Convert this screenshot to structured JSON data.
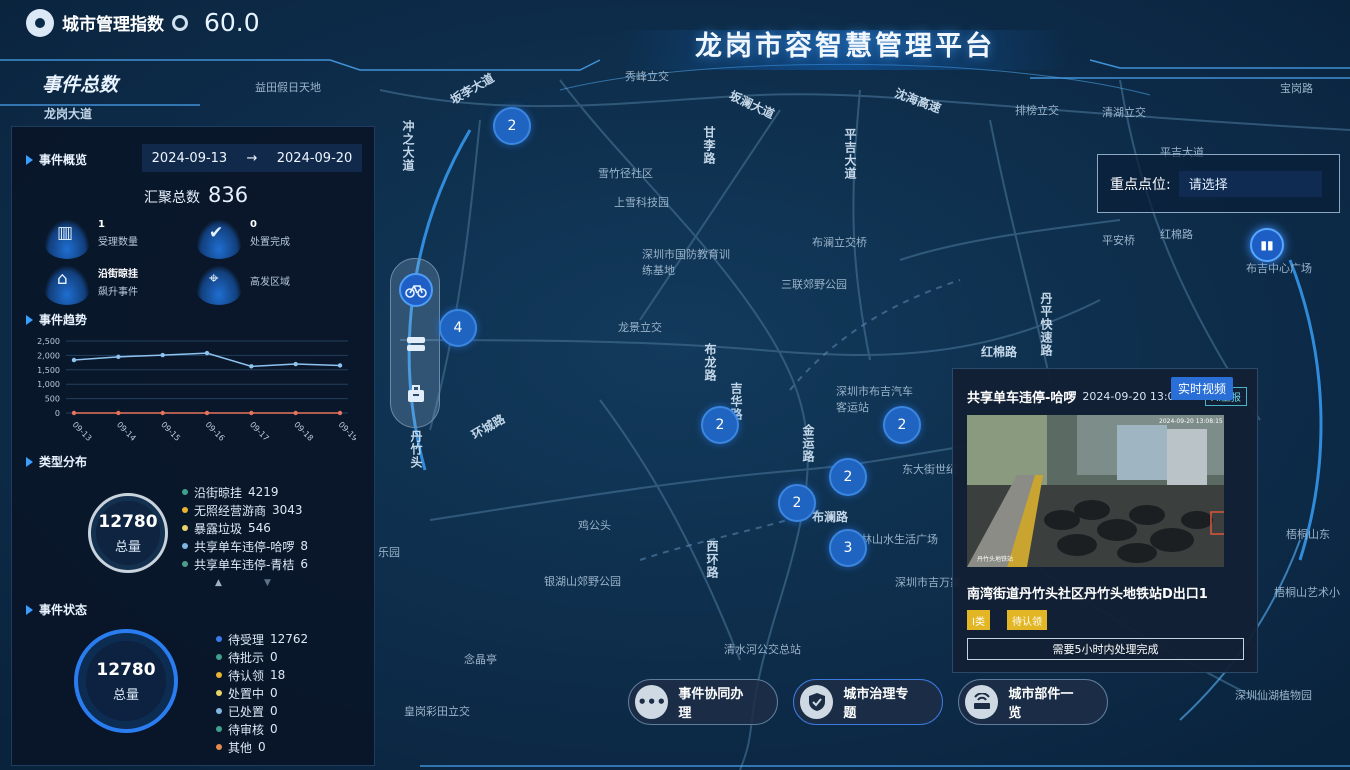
{
  "header": {
    "city_index_label": "城市管理指数",
    "city_index_value": "60.0",
    "platform_title": "龙岗市容智慧管理平台",
    "section_title": "事件总数"
  },
  "overview": {
    "title": "事件概览",
    "date_start": "2024-09-13",
    "date_arrow": "→",
    "date_end": "2024-09-20",
    "total_label": "汇聚总数",
    "total_value": "836",
    "kpis": [
      {
        "value": "1",
        "label": "受理数量",
        "icon": "books-icon"
      },
      {
        "value": "0",
        "label": "处置完成",
        "icon": "check-icon"
      },
      {
        "value": "沿街晾挂",
        "label": "飙升事件",
        "icon": "shop-icon"
      },
      {
        "value": "",
        "label": "高发区域",
        "icon": "location-pin-icon"
      }
    ]
  },
  "trend": {
    "title": "事件趋势"
  },
  "chart_data": {
    "type": "line",
    "categories": [
      "09-13",
      "09-14",
      "09-15",
      "09-16",
      "09-17",
      "09-18",
      "09-19"
    ],
    "y_ticks": [
      "2,500",
      "2,000",
      "1,500",
      "1,000",
      "500",
      "0"
    ],
    "ylim": [
      0,
      2500
    ],
    "series": [
      {
        "values": [
          1840,
          1950,
          2010,
          2080,
          1620,
          1700,
          1650
        ],
        "color": "#8ec3ef"
      },
      {
        "values": [
          0,
          0,
          0,
          0,
          0,
          0,
          0
        ],
        "color": "#e8735c"
      }
    ],
    "grid": true
  },
  "type_dist": {
    "title": "类型分布",
    "total": "12780",
    "total_label": "总量",
    "items": [
      {
        "name": "沿街晾挂",
        "value": "4219",
        "color": "#3fa28a"
      },
      {
        "name": "无照经营游商",
        "value": "3043",
        "color": "#e8b431"
      },
      {
        "name": "暴露垃圾",
        "value": "546",
        "color": "#e8d36a"
      },
      {
        "name": "共享单车违停-哈啰",
        "value": "8",
        "color": "#7fb7e2"
      },
      {
        "name": "共享单车违停-青桔",
        "value": "6",
        "color": "#4e9e8c"
      }
    ]
  },
  "status": {
    "title": "事件状态",
    "total": "12780",
    "total_label": "总量",
    "items": [
      {
        "name": "待受理",
        "value": "12762",
        "color": "#3a7bf0"
      },
      {
        "name": "待批示",
        "value": "0",
        "color": "#3fa28a"
      },
      {
        "name": "待认领",
        "value": "18",
        "color": "#e8b431"
      },
      {
        "name": "处置中",
        "value": "0",
        "color": "#e8d36a"
      },
      {
        "name": "已处置",
        "value": "0",
        "color": "#7fb7e2"
      },
      {
        "name": "待审核",
        "value": "0",
        "color": "#3fa28a"
      },
      {
        "name": "其他",
        "value": "0",
        "color": "#e68a4f"
      }
    ]
  },
  "clusters": [
    "2",
    "4",
    "2",
    "2",
    "2",
    "2",
    "3"
  ],
  "tool_bar": [
    "bicycle-icon",
    "stack-icon",
    "briefcase-icon"
  ],
  "keypoint": {
    "label": "重点点位:",
    "placeholder": "请选择"
  },
  "event_card": {
    "title": "共享单车违停-哈啰",
    "datetime": "2024-09-20 13:08:20",
    "ai_tag": "AI上报",
    "live_label": "实时视频",
    "address": "南湾街道丹竹头社区丹竹头地铁站D出口1",
    "tags": [
      "I类",
      "待认领"
    ],
    "deadline": "需要5小时内处理完成"
  },
  "bottom_nav": [
    {
      "label": "事件协同办理",
      "icon": "chat-icon"
    },
    {
      "label": "城市治理专题",
      "icon": "shield-icon"
    },
    {
      "label": "城市部件一览",
      "icon": "router-icon"
    }
  ],
  "map_labels": {
    "roads": [
      "龙岗大道",
      "坂李大道",
      "布龙路",
      "坂澜大道",
      "沈海高速",
      "丹平快速路",
      "吉华路",
      "环城路",
      "布澜路",
      "金运路",
      "平吉大道",
      "西环路",
      "红棉路",
      "冲之大道",
      "甘李路",
      "环城路",
      "丹竹头"
    ],
    "places": [
      "深圳市国防教育训练基地",
      "雪竹径社区",
      "上雪科技园",
      "三联郊野公园",
      "龙景立交",
      "布澜立交桥",
      "深圳市布吉汽车客运站",
      "东大街世纪",
      "桂林山水生活广场",
      "鸡公头",
      "银湖山郊野公园",
      "念晶亭",
      "清水河公交总站",
      "皇岗彩田立交",
      "益田假日天地",
      "平安桥",
      "红棉路",
      "平吉大道",
      "深圳仙湖植物园",
      "梧桐山艺术小",
      "梧桐山东",
      "深圳市吉万家",
      "秀峰立交",
      "排榜立交",
      "清湖立交",
      "宝岗路",
      "布吉中心广场",
      "乐园",
      "龙岗大道"
    ]
  }
}
